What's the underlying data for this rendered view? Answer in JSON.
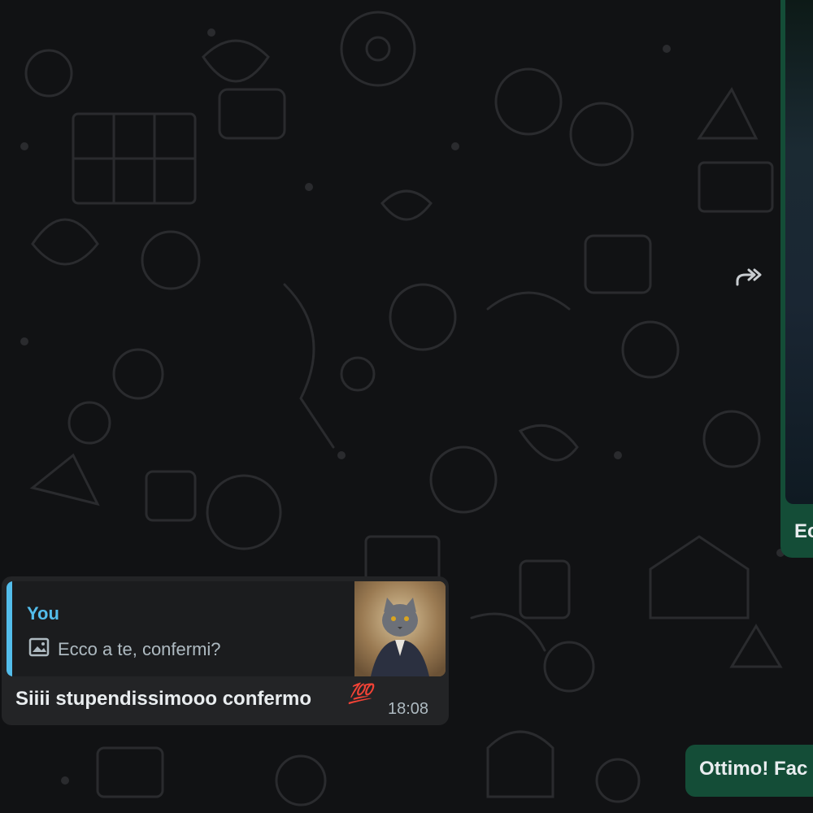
{
  "colors": {
    "background": "#111214",
    "outgoing_bubble": "#144d37",
    "incoming_bubble": "#232426",
    "quote_accent": "#53bdeb",
    "timestamp": "#aebac1"
  },
  "wallpaper": {
    "icon": "doodle-pattern"
  },
  "media_message": {
    "caption": "Ec",
    "forward_icon": "forward-icon"
  },
  "reply_message": {
    "quoted": {
      "author": "You",
      "media_icon": "image-icon",
      "text": "Ecco a te, confermi?"
    },
    "text": "Siiii stupendissimooo confermo",
    "emoji": "💯",
    "time": "18:08"
  },
  "outgoing_message": {
    "text": "Ottimo! Fac"
  }
}
